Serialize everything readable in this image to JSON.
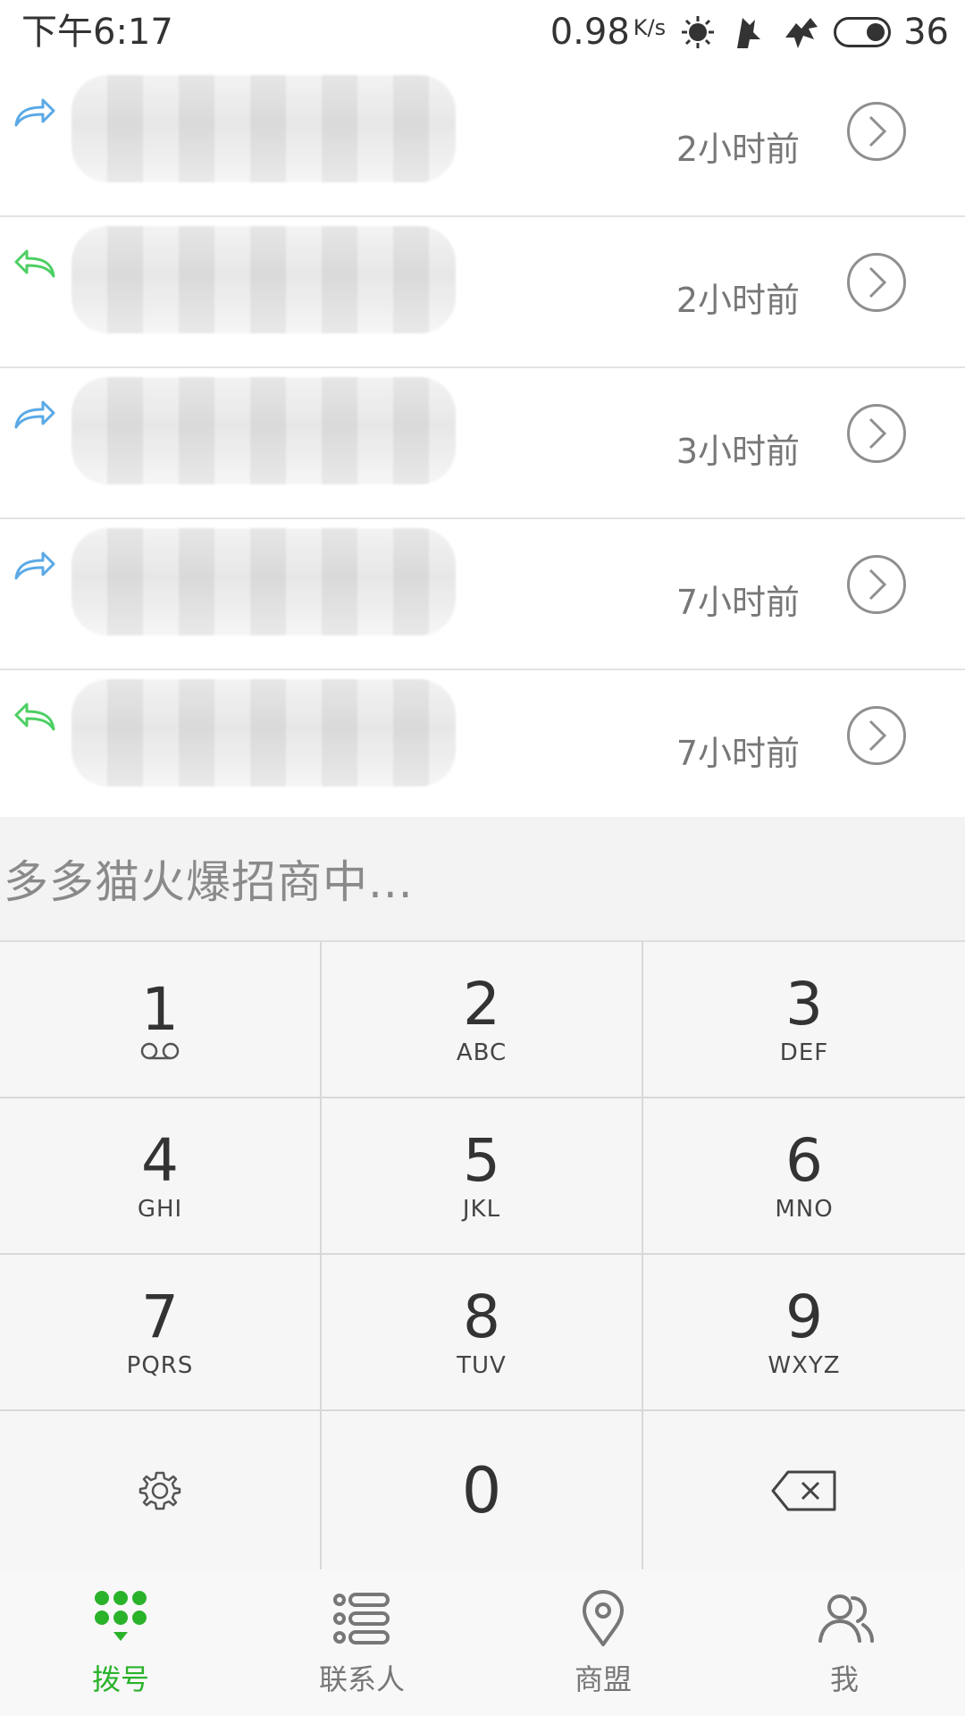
{
  "status_bar": {
    "time": "下午6:17",
    "network_speed": "0.98",
    "speed_unit": "K/s",
    "battery": "36"
  },
  "call_log": {
    "items": [
      {
        "direction": "outgoing",
        "time": "2小时前"
      },
      {
        "direction": "incoming",
        "time": "2小时前"
      },
      {
        "direction": "outgoing",
        "time": "3小时前"
      },
      {
        "direction": "outgoing",
        "time": "7小时前"
      },
      {
        "direction": "incoming",
        "time": "7小时前"
      }
    ]
  },
  "banner": {
    "text": "多多猫火爆招商中..."
  },
  "dialpad": {
    "keys": [
      {
        "digit": "1",
        "letters": ""
      },
      {
        "digit": "2",
        "letters": "ABC"
      },
      {
        "digit": "3",
        "letters": "DEF"
      },
      {
        "digit": "4",
        "letters": "GHI"
      },
      {
        "digit": "5",
        "letters": "JKL"
      },
      {
        "digit": "6",
        "letters": "MNO"
      },
      {
        "digit": "7",
        "letters": "PQRS"
      },
      {
        "digit": "8",
        "letters": "TUV"
      },
      {
        "digit": "9",
        "letters": "WXYZ"
      },
      {
        "digit": "0",
        "letters": ""
      }
    ]
  },
  "bottom_nav": {
    "items": [
      {
        "label": "拨号",
        "icon": "dialpad-icon",
        "active": true
      },
      {
        "label": "联系人",
        "icon": "contacts-list-icon",
        "active": false
      },
      {
        "label": "商盟",
        "icon": "location-pin-icon",
        "active": false
      },
      {
        "label": "我",
        "icon": "profile-icon",
        "active": false
      }
    ]
  },
  "colors": {
    "accent_green": "#2bb22b",
    "outgoing_blue": "#5aa9e6",
    "incoming_green": "#4ccf63",
    "text_gray": "#777777"
  }
}
